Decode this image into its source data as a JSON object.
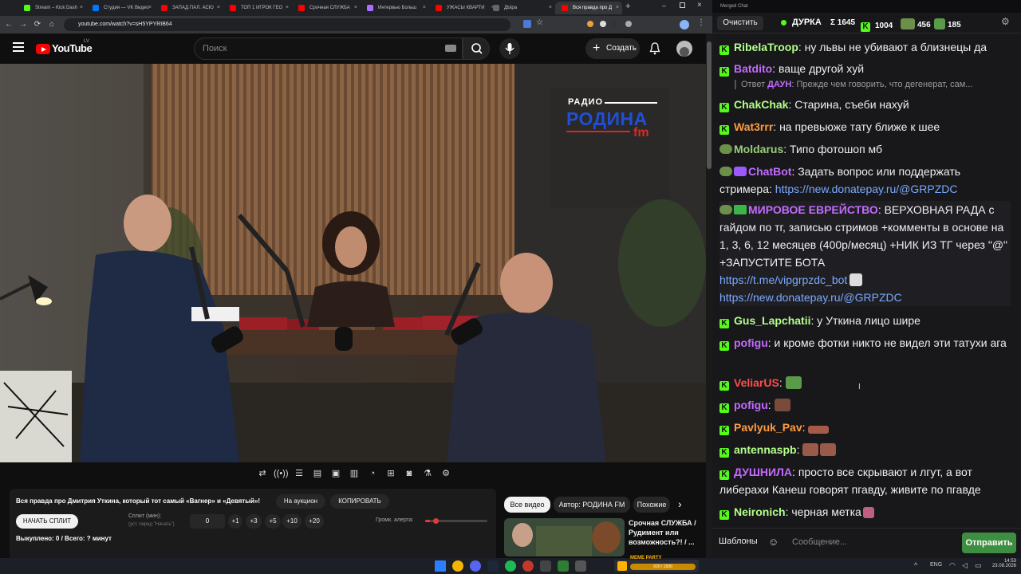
{
  "browser": {
    "tabs": [
      {
        "title": "Stream – Kick Dash",
        "color": "#53fc18"
      },
      {
        "title": "Студия — VK Видео",
        "color": "#0077ff"
      },
      {
        "title": "ЗАПАД ПАЛ. АСЮ",
        "color": "#ff0000"
      },
      {
        "title": "ТОП 1 ИГРОК ГЕО",
        "color": "#ff0000"
      },
      {
        "title": "Срочная СЛУЖБА",
        "color": "#ff0000"
      },
      {
        "title": "Интервью Больш",
        "color": "#a970ff"
      },
      {
        "title": "УЖАСЫ КВАРТИ",
        "color": "#ff0000"
      },
      {
        "title": "ДЫра",
        "color": "#666666"
      },
      {
        "title": "Вся правда про Д",
        "color": "#ff0000"
      }
    ],
    "url": "youtube.com/watch?v=sH5YPYRIB64"
  },
  "youtube": {
    "region": "LV",
    "logo_text": "YouTube",
    "search_placeholder": "Поиск",
    "create_label": "Создать"
  },
  "video": {
    "overlay_logo_top": "РАДИО",
    "overlay_logo_main": "РОДИНА",
    "overlay_logo_fm": "fm"
  },
  "panel": {
    "title": "Вся правда про Дмитрия Уткина, который тот самый «Вагнер» и «Девятый»!",
    "auction_label": "На аукцион",
    "copy_label": "КОПИРОВАТЬ",
    "start_split_label": "НАЧАТЬ СПЛИТ",
    "split_label": "Сплит (мин):",
    "split_hint": "(уст. перед \"Начать\")",
    "split_value": "0",
    "steps": [
      "+1",
      "+3",
      "+5",
      "+10",
      "+20"
    ],
    "alert_volume_label": "Громк. алерта:",
    "alert_volume_fraction": 0.08,
    "bought_label": "Выкуплено: 0 / Всего: ? минут"
  },
  "related": {
    "tabs": [
      "Все видео",
      "Автор: РОДИНА FM",
      "Похожие"
    ],
    "video_title": "Срочная СЛУЖБА / Рудимент или возможность?! / ...",
    "badge": "MEME PARTY",
    "progress_text": "920 / 1500"
  },
  "chat": {
    "window_title": "Merged Chat",
    "clear_label": "Очистить",
    "streamer": "ДУРКА",
    "stats": {
      "sigma": "Σ 1645",
      "kick": "1004",
      "twitch": "456",
      "other": "185"
    },
    "messages": [
      {
        "user": "RibelaTroop",
        "color": "#b5ff8a",
        "text": "ну львы не убивают а близнецы да"
      },
      {
        "user": "Batdito",
        "color": "#c36bff",
        "text": "ваще другой хуй"
      },
      {
        "reply_prefix": "Ответ",
        "reply_user": "ДАУН",
        "reply_text": "Прежде чем говорить, что дегенерат, сам..."
      },
      {
        "user": "ChakChak",
        "color": "#b5ff8a",
        "text": "Старина, съеби нахуй"
      },
      {
        "user": "Wat3rrr",
        "color": "#ff9b3d",
        "text": "на превьюже тату ближе к шее"
      },
      {
        "user": "Moldarus",
        "color": "#9acd7a",
        "text": "Типо фотошоп мб"
      },
      {
        "user": "ChatBot",
        "color": "#c36bff",
        "text": "Задать вопрос или поддержать стримера:",
        "link": "https://new.donatepay.ru/@GRPZDC"
      },
      {
        "user": "МИРОВОЕ ЕВРЕЙСТВО",
        "color": "#c36bff",
        "text": "ВЕРХОВНАЯ РАДА с гайдом по тг, записью стримов +комменты в основе  на 1, 3, 6, 12 месяцев (400р/месяц) +НИК ИЗ ТГ через \"@\" +ЗАПУСТИТЕ БОТА",
        "link": "https://t.me/vipgrpzdc_bot",
        "link2": "https://new.donatepay.ru/@GRPZDC"
      },
      {
        "user": "Gus_Lapchatii",
        "color": "#b5ff8a",
        "text": "у Уткина лицо шире"
      },
      {
        "user": "pofigu",
        "color": "#c36bff",
        "text": "и кроме фотки никто не видел эти татухи ага"
      },
      {
        "user": "VeliarUS",
        "color": "#ff4d4d",
        "text": ""
      },
      {
        "user": "pofigu",
        "color": "#c36bff",
        "text": ""
      },
      {
        "user": "Pavlyuk_Pav",
        "color": "#ff9b3d",
        "text": ""
      },
      {
        "user": "antennaspb",
        "color": "#b5ff8a",
        "text": ""
      },
      {
        "user": "ДУШНИЛА",
        "color": "#c36bff",
        "text": "просто все скрывают и лгут, а вот либерахи Канеш говорят пгавду, живите по пгавде"
      },
      {
        "user": "Neironich",
        "color": "#b5ff8a",
        "text": "черная метка"
      }
    ],
    "templates_label": "Шаблоны",
    "input_placeholder": "Сообщение...",
    "send_label": "Отправить"
  },
  "taskbar": {
    "lang": "ENG",
    "time": "14:53",
    "date": "23.08.2026"
  }
}
